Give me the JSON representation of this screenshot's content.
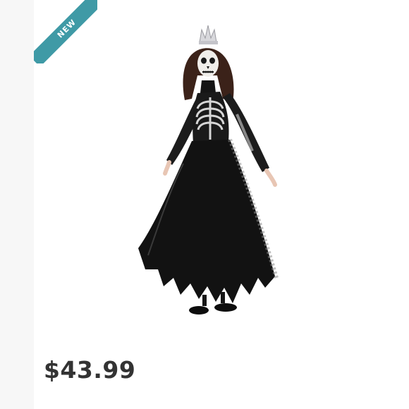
{
  "product": {
    "badge_label": "NEW",
    "price": "$43.99",
    "image_subject": "child-skeleton-queen-costume"
  },
  "colors": {
    "badge": "#3f9aa6",
    "price_text": "#333333",
    "gutter": "#f7f7f7",
    "background": "#ffffff"
  }
}
